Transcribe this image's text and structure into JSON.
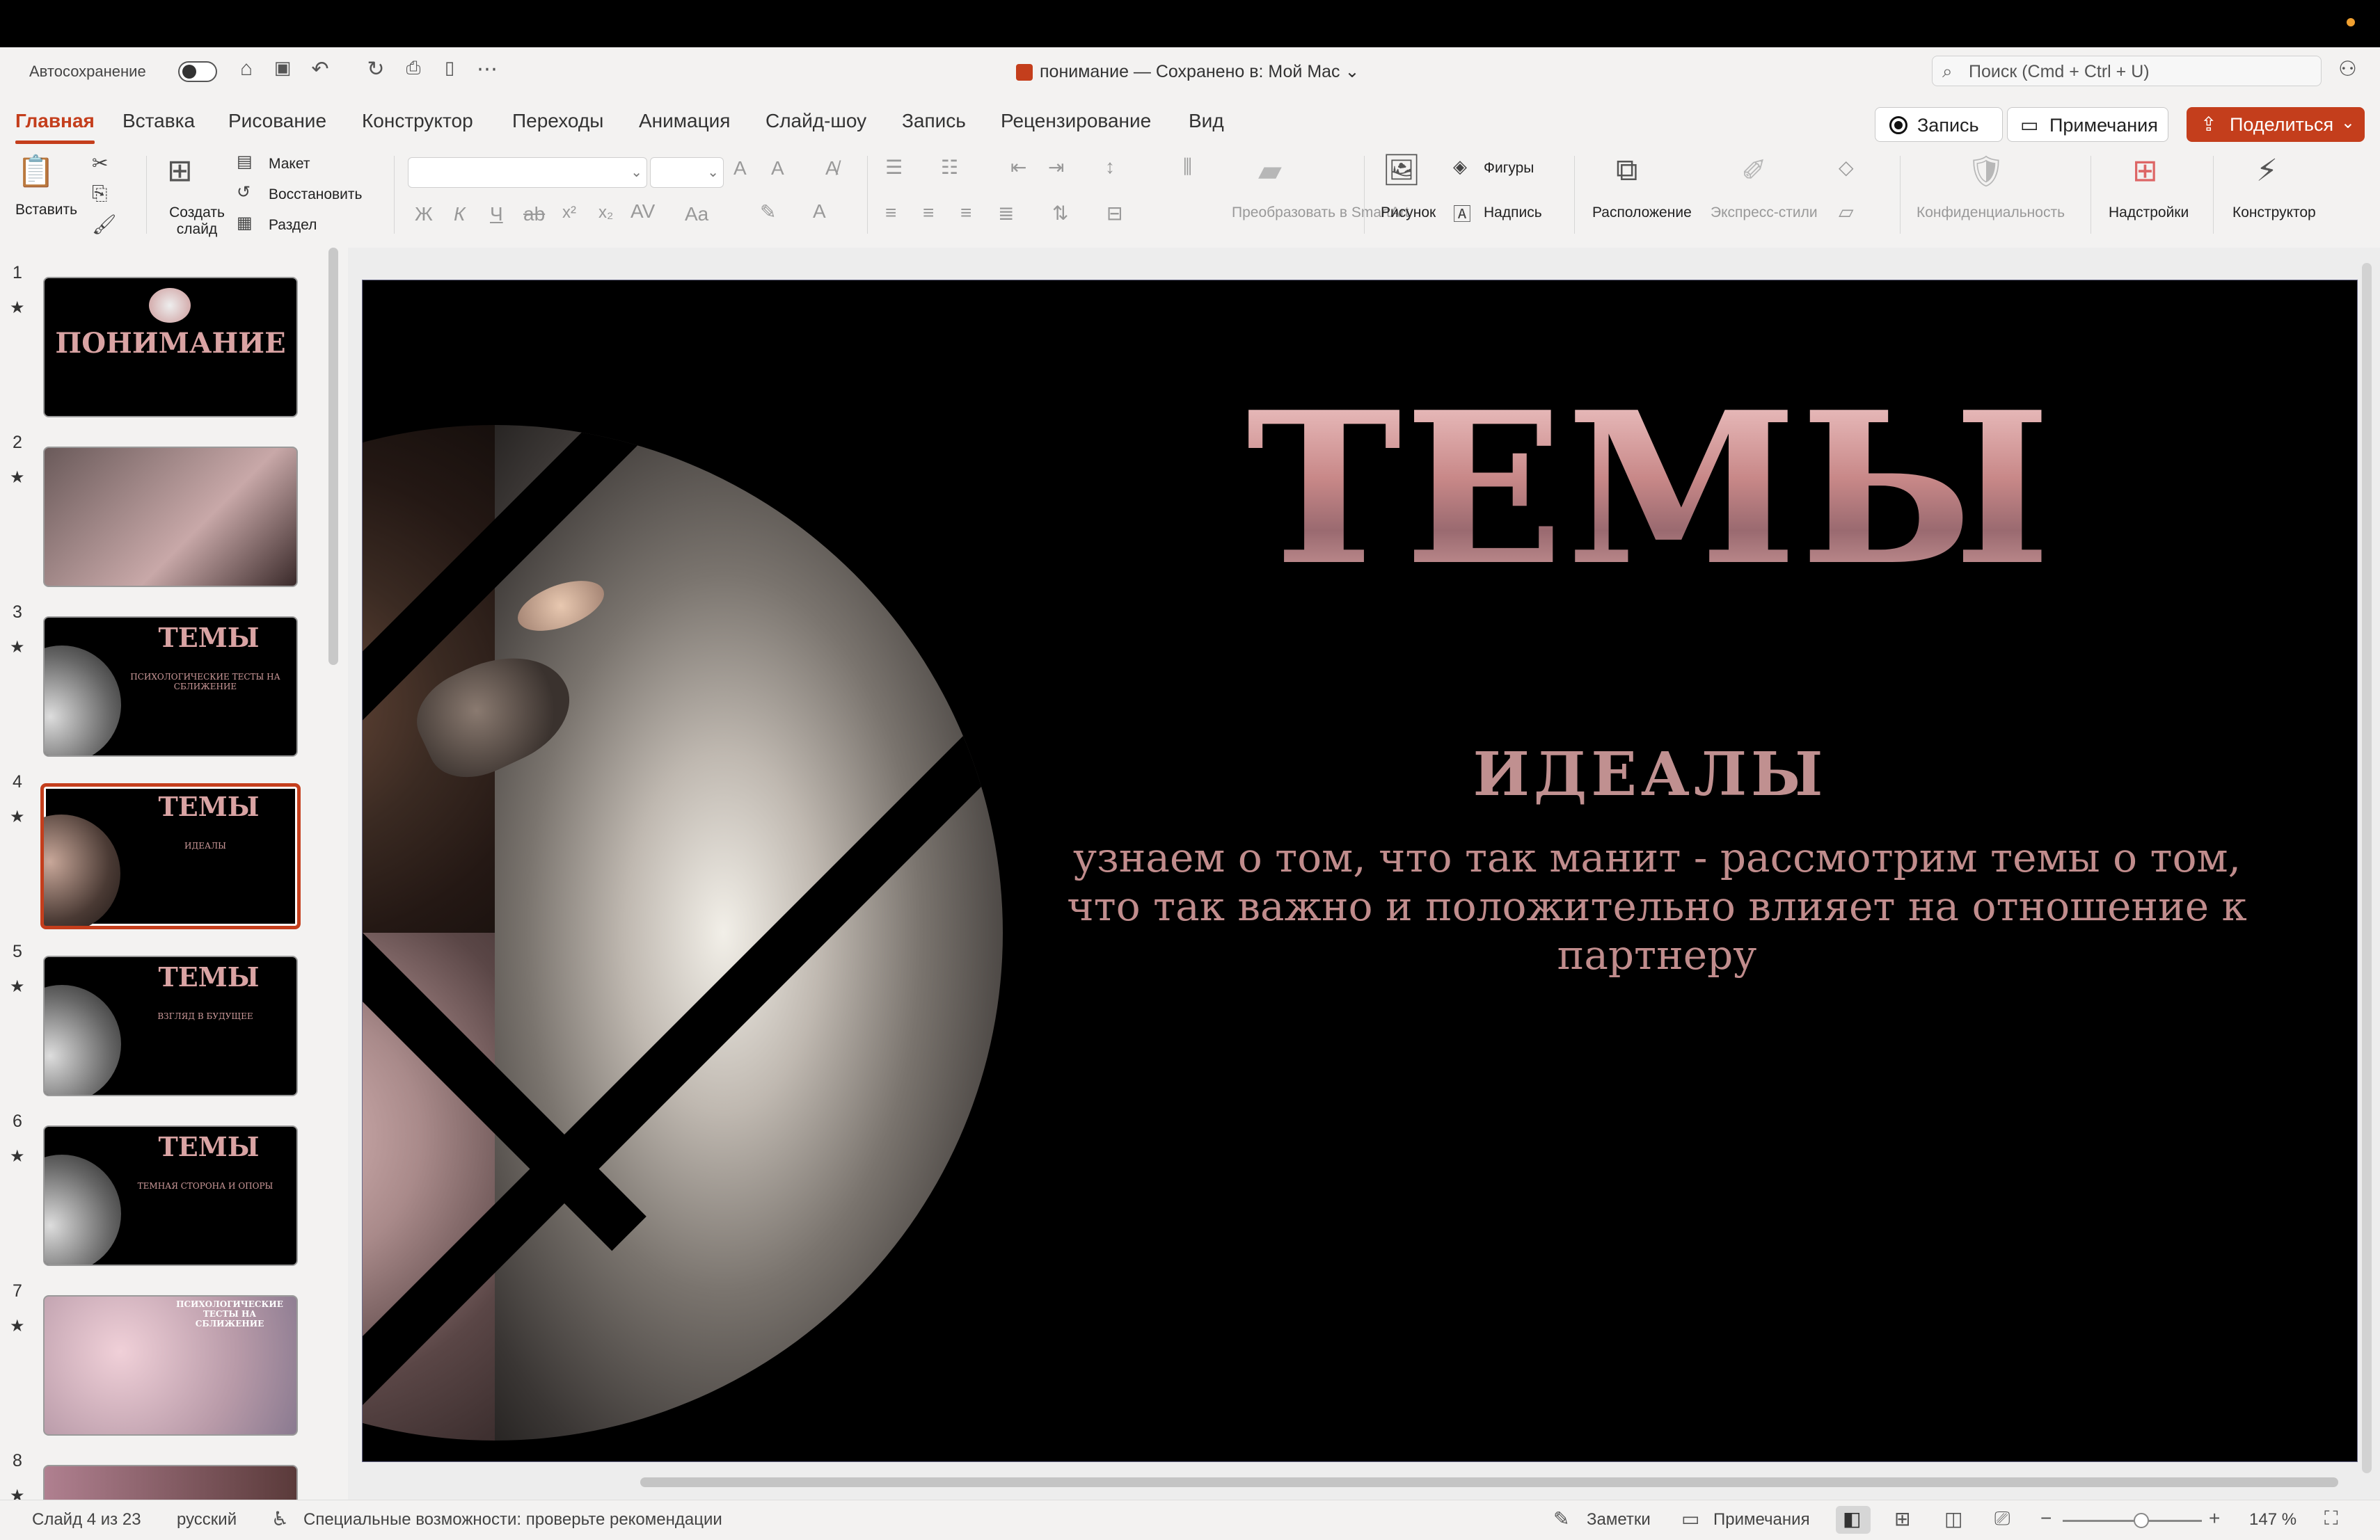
{
  "window": {
    "autosave_label": "Автосохранение",
    "doc_title": "понимание — Сохранено в: Мой Mac",
    "title_chevron": "⌄",
    "search_placeholder": "Поиск (Cmd + Ctrl + U)"
  },
  "tabs": [
    "Главная",
    "Вставка",
    "Рисование",
    "Конструктор",
    "Переходы",
    "Анимация",
    "Слайд-шоу",
    "Запись",
    "Рецензирование",
    "Вид"
  ],
  "header_buttons": {
    "record": "Запись",
    "comments": "Примечания",
    "share": "Поделиться"
  },
  "ribbon": {
    "paste": "Вставить",
    "new_slide": "Создать слайд",
    "layout": "Макет",
    "reset": "Восстановить",
    "section": "Раздел",
    "font_bold": "Ж",
    "font_italic": "К",
    "font_underline": "Ч",
    "font_strike": "ab",
    "superscript": "x²",
    "subscript": "x₂",
    "smartart": "Преобразовать в SmartArt",
    "picture": "Рисунок",
    "shapes": "Фигуры",
    "textbox": "Надпись",
    "arrange": "Расположение",
    "quick_styles": "Экспресс-стили",
    "privacy": "Конфиденциальность",
    "addins": "Надстройки",
    "designer": "Конструктор"
  },
  "thumbnails": [
    {
      "num": "1",
      "star": "★",
      "title": "ПОНИМАНИЕ",
      "subtitle": "",
      "style": "intro"
    },
    {
      "num": "2",
      "star": "★",
      "title": "",
      "subtitle": "",
      "style": "photo"
    },
    {
      "num": "3",
      "star": "★",
      "title": "ТЕМЫ",
      "subtitle": "ПСИХОЛОГИЧЕСКИЕ ТЕСТЫ НА СБЛИЖЕНИЕ",
      "style": "dark"
    },
    {
      "num": "4",
      "star": "★",
      "title": "ТЕМЫ",
      "subtitle": "ИДЕАЛЫ",
      "style": "dark",
      "selected": true
    },
    {
      "num": "5",
      "star": "★",
      "title": "ТЕМЫ",
      "subtitle": "ВЗГЛЯД В БУДУЩЕЕ",
      "style": "dark"
    },
    {
      "num": "6",
      "star": "★",
      "title": "ТЕМЫ",
      "subtitle": "ТЕМНАЯ СТОРОНА И ОПОРЫ",
      "style": "dark"
    },
    {
      "num": "7",
      "star": "★",
      "title": "ПСИХОЛОГИЧЕСКИЕ ТЕСТЫ НА СБЛИЖЕНИЕ",
      "subtitle": "",
      "style": "pink"
    },
    {
      "num": "8",
      "star": "★",
      "title": "",
      "subtitle": "",
      "style": "pinkdark"
    }
  ],
  "slide": {
    "title": "ТЕМЫ",
    "subtitle": "ИДЕАЛЫ",
    "body": "узнаем о том, что так манит - рассмотрим темы о том, что так важно и положительно влияет на отношение к партнеру"
  },
  "status": {
    "slide_counter": "Слайд 4 из 23",
    "language": "русский",
    "accessibility": "Специальные возможности: проверьте рекомендации",
    "notes": "Заметки",
    "comments": "Примечания",
    "zoom": "147 %"
  },
  "colors": {
    "accent": "#c43e1c",
    "slide_bg": "#000000",
    "title_rose": "#d59a9a"
  },
  "icons": [
    "home-icon",
    "save-icon",
    "undo-icon",
    "redo-icon",
    "search-icon",
    "record-icon",
    "comment-icon",
    "share-icon",
    "picture-icon",
    "shapes-icon",
    "textbox-icon"
  ]
}
